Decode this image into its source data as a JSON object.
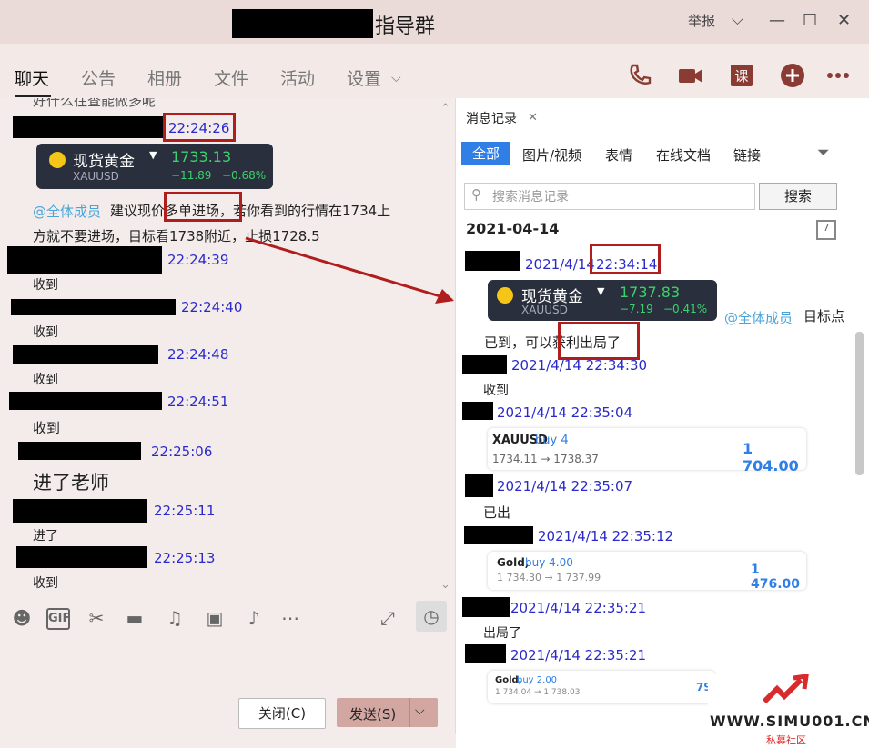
{
  "window": {
    "title": "指导群",
    "report": "举报"
  },
  "nav": {
    "tabs": [
      "聊天",
      "公告",
      "相册",
      "文件",
      "活动",
      "设置"
    ]
  },
  "left": {
    "top_partial": "好什么往查能做多呢",
    "msgs": {
      "t1": "22:24:26",
      "gold_name": "现货黄金",
      "gold_code": "XAUUSD",
      "gold_price": "1733.13",
      "gold_change": "−11.89",
      "gold_pct": "−0.68%",
      "mention": "@全体成员",
      "advice": "建议现价多单进场，若你看到的行情在1734上",
      "advice2": "方就不要进场，目标看1738附近，止损1728.5",
      "t2": "22:24:39",
      "m2": "收到",
      "t3": "22:24:40",
      "m3": "收到",
      "t4": "22:24:48",
      "m4": "收到",
      "t5": "22:24:51",
      "m5": "收到",
      "t6": "22:25:06",
      "m6": "进了老师",
      "t7": "22:25:11",
      "m7": "进了",
      "t8": "22:25:13",
      "m8": "收到"
    }
  },
  "buttons": {
    "close": "关闭(C)",
    "send": "发送(S)"
  },
  "right": {
    "header": "消息记录",
    "tabs": [
      "全部",
      "图片/视频",
      "表情",
      "在线文档",
      "链接"
    ],
    "search_placeholder": "搜索消息记录",
    "search_button": "搜索",
    "date": "2021-04-14",
    "r1_date": "2021/4/14",
    "r1_time": "22:34:14",
    "gold_name": "现货黄金",
    "gold_code": "XAUUSD",
    "gold_price": "1737.83",
    "gold_change": "−7.19",
    "gold_pct": "−0.41%",
    "mention": "@全体成员",
    "target": "目标点",
    "reached": "已到，可以获利出局了",
    "r2_time": "2021/4/14 22:34:30",
    "r2_msg": "收到",
    "r3_time": "2021/4/14 22:35:04",
    "card1_sym": "XAUUSD",
    "card1_side": "buy 4",
    "card1_range": "1734.11 → 1738.37",
    "card1_profit": "1 704.00",
    "r4_time": "2021/4/14 22:35:07",
    "r4_msg": "已出",
    "r5_time": "2021/4/14 22:35:12",
    "card2_sym": "Gold,",
    "card2_side": "buy 4.00",
    "card2_range": "1 734.30 → 1 737.99",
    "card2_profit": "1 476.00",
    "r6_time": "2021/4/14 22:35:21",
    "r6_msg": "出局了",
    "r7_time": "2021/4/14 22:35:21",
    "card3_sym": "Gold,",
    "card3_side": "buy 2.00",
    "card3_range": "1 734.04 → 1 738.03",
    "card3_profit": "79"
  },
  "watermark": {
    "site": "WWW.SIMU001.CN",
    "sub": "私募社区"
  },
  "colors": {
    "accent": "#2f7fe6",
    "highlight": "#b01d1d",
    "link": "#2a2acc"
  }
}
